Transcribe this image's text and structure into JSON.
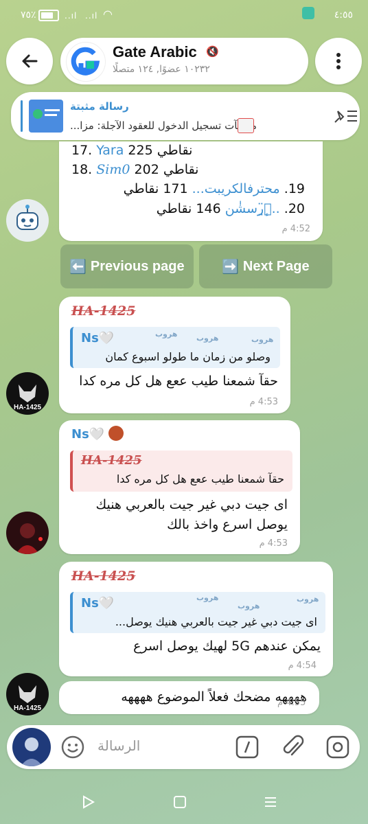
{
  "status_bar": {
    "time": "٤:٥٥",
    "battery": "٧٥٪",
    "signal": "..ıl"
  },
  "header": {
    "title": "Gate Arabic",
    "subtitle": "١٠٢٣٢ عضوًا, ١٢٤ متصلًا"
  },
  "pinned": {
    "label": "رسالة مثبتة",
    "text": "مكافآت تسجيل الدخول للعقود الآجلة: مزا..."
  },
  "leaderboard": {
    "rows": [
      {
        "rank": "17.",
        "name": "Yara",
        "points": "225",
        "unit": "نقاطي"
      },
      {
        "rank": "18.",
        "name": "Sim0",
        "points": "202",
        "unit": "نقاطي"
      },
      {
        "rank": "19.",
        "name": "محترفالكريبت...",
        "points": "171",
        "unit": "نقاطي"
      },
      {
        "rank": "20.",
        "name": "..ٱ̤ٕ̈رسشٰٰٰن",
        "points": "146",
        "unit": "نقاطي"
      }
    ],
    "time": "4:52 م"
  },
  "nav": {
    "prev": "Previous page",
    "next": "Next Page",
    "prev_icon": "⬅️",
    "next_icon": "➡️"
  },
  "messages": [
    {
      "sender": "HA-1425",
      "reply_name": "Ns🤍",
      "reply_text": "وصلو من زمان ما طولو اسبوع كمان",
      "text": "حقآ شمعنا طيب ععع هل كل مره كدا",
      "time": "4:53 م"
    },
    {
      "sender": "Ns🤍",
      "reply_name": "HA-1425",
      "reply_text": "حقآ شمعنا طيب ععع هل كل مره كدا",
      "text1": "اى جيت دبي غير جيت بالعربي هنيك",
      "text2": "يوصل اسرع واخذ بالك",
      "time": "4:53 م"
    },
    {
      "sender": "HA-1425",
      "reply_name": "Ns🤍",
      "reply_text": "اى جيت دبي غير جيت بالعربي هنيك يوصل...",
      "text": "يمكن عندهم 5G لهيك يوصل اسرع",
      "time": "4:54 م"
    },
    {
      "text": "ههههه مضحك فعلاً الموضوع ههههه",
      "time": "4:55 م"
    }
  ],
  "input": {
    "placeholder": "الرسالة"
  },
  "watermark": "هروب",
  "colors": {
    "accent_blue": "#3c8fd0",
    "sender_red": "#c95050",
    "background": "#a9c98a"
  }
}
